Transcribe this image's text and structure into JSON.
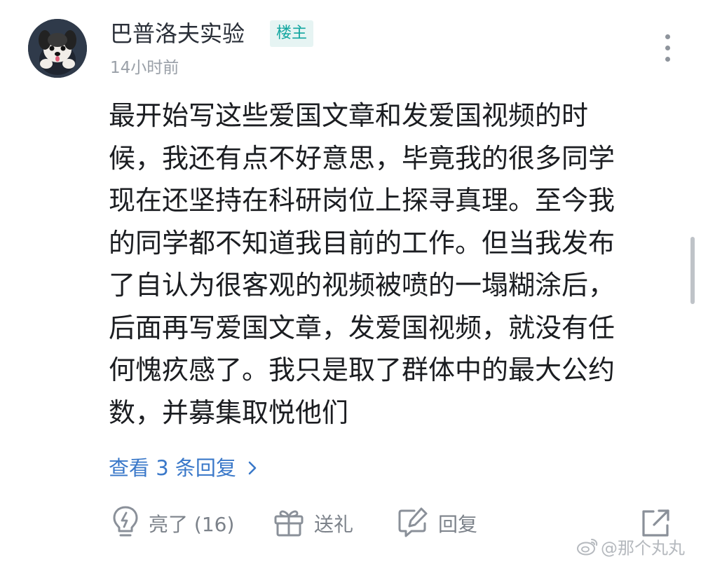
{
  "comment": {
    "author": {
      "name": "巴普洛夫实验",
      "badge": "楼主",
      "avatar": "dog-avatar"
    },
    "timestamp": "14小时前",
    "menu_icon": "more-vertical-icon",
    "text_lines": [
      "最开始写这些爱国文章和发爱国视频的时",
      "候，我还有点不好意思，毕竟我的很多同学",
      "现在还坚持在科研岗位上探寻真理。至今我",
      "的同学都不知道我目前的工作。但当我发布",
      "了自认为很客观的视频被喷的一塌糊涂后，",
      "后面再写爱国文章，发爱国视频，就没有任",
      "何愧疚感了。我只是取了群体中的最大公约",
      "数，并募集取悦他们"
    ],
    "view_replies": "查看 3 条回复"
  },
  "actions": {
    "like": {
      "label": "亮了 (16)",
      "icon": "lightbulb-icon"
    },
    "gift": {
      "label": "送礼",
      "icon": "gift-icon"
    },
    "reply": {
      "label": "回复",
      "icon": "edit-reply-icon"
    },
    "share": {
      "icon": "share-external-icon"
    }
  },
  "watermark": "@那个丸丸",
  "colors": {
    "badge_bg": "#e6f4f3",
    "badge_text": "#12a6a0",
    "link": "#3a78c9",
    "body_text": "#1b1d21",
    "muted": "#7c828a"
  }
}
